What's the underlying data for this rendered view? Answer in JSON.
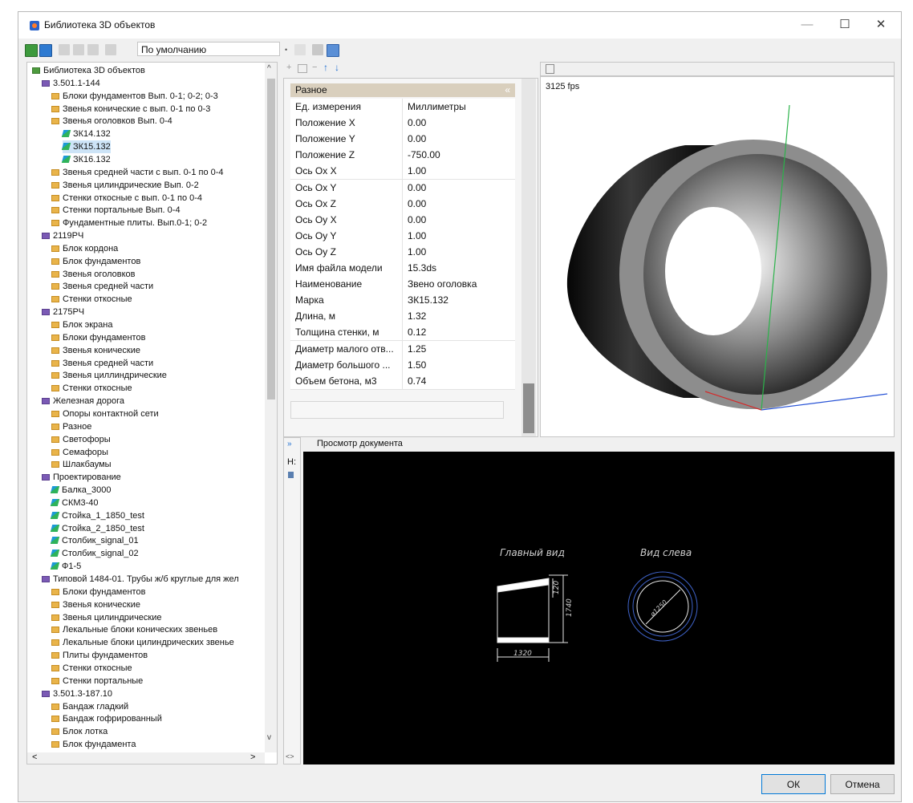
{
  "window": {
    "title": "Библиотека 3D объектов",
    "min_glyph": "—",
    "max_glyph": "☐",
    "close_glyph": "✕"
  },
  "toolbar": {
    "preset_value": "По умолчанию"
  },
  "tree": {
    "scroll_up": "^",
    "scroll_down": "v",
    "scroll_left": "<",
    "scroll_right": ">",
    "items": [
      {
        "label": "Библиотека 3D объектов",
        "level": 0,
        "icon": "lib"
      },
      {
        "label": "3.501.1-144",
        "level": 1,
        "icon": "grp"
      },
      {
        "label": "Блоки фундаментов Вып. 0-1; 0-2; 0-3",
        "level": 2,
        "icon": "folder"
      },
      {
        "label": "Звенья конические с вып. 0-1 по 0-3",
        "level": 2,
        "icon": "folder"
      },
      {
        "label": "Звенья оголовков Вып. 0-4",
        "level": 2,
        "icon": "folder"
      },
      {
        "label": "ЗК14.132",
        "level": 3,
        "icon": "obj"
      },
      {
        "label": "ЗК15.132",
        "level": 3,
        "icon": "obj",
        "selected": true
      },
      {
        "label": "ЗК16.132",
        "level": 3,
        "icon": "obj"
      },
      {
        "label": "Звенья средней части с вып. 0-1 по 0-4",
        "level": 2,
        "icon": "folder"
      },
      {
        "label": "Звенья цилиндрические Вып. 0-2",
        "level": 2,
        "icon": "folder"
      },
      {
        "label": "Стенки откосные с вып. 0-1 по 0-4",
        "level": 2,
        "icon": "folder"
      },
      {
        "label": "Стенки портальные Вып. 0-4",
        "level": 2,
        "icon": "folder"
      },
      {
        "label": "Фундаментные плиты. Вып.0-1; 0-2",
        "level": 2,
        "icon": "folder"
      },
      {
        "label": "2119РЧ",
        "level": 1,
        "icon": "grp"
      },
      {
        "label": "Блок кордона",
        "level": 2,
        "icon": "folder"
      },
      {
        "label": "Блок фундаментов",
        "level": 2,
        "icon": "folder"
      },
      {
        "label": "Звенья оголовков",
        "level": 2,
        "icon": "folder"
      },
      {
        "label": "Звенья средней части",
        "level": 2,
        "icon": "folder"
      },
      {
        "label": "Стенки откосные",
        "level": 2,
        "icon": "folder"
      },
      {
        "label": "2175РЧ",
        "level": 1,
        "icon": "grp"
      },
      {
        "label": "Блок экрана",
        "level": 2,
        "icon": "folder"
      },
      {
        "label": "Блоки фундаментов",
        "level": 2,
        "icon": "folder"
      },
      {
        "label": "Звенья конические",
        "level": 2,
        "icon": "folder"
      },
      {
        "label": "Звенья средней части",
        "level": 2,
        "icon": "folder"
      },
      {
        "label": "Звенья циллиндрические",
        "level": 2,
        "icon": "folder"
      },
      {
        "label": "Стенки откосные",
        "level": 2,
        "icon": "folder"
      },
      {
        "label": "Железная дорога",
        "level": 1,
        "icon": "grp"
      },
      {
        "label": "Опоры контактной сети",
        "level": 2,
        "icon": "folder"
      },
      {
        "label": "Разное",
        "level": 2,
        "icon": "folder"
      },
      {
        "label": "Светофоры",
        "level": 2,
        "icon": "folder"
      },
      {
        "label": "Семафоры",
        "level": 2,
        "icon": "folder"
      },
      {
        "label": "Шлакбаумы",
        "level": 2,
        "icon": "folder"
      },
      {
        "label": "Проектирование",
        "level": 1,
        "icon": "grp"
      },
      {
        "label": "Балка_3000",
        "level": 2,
        "icon": "obj"
      },
      {
        "label": "СКМ3-40",
        "level": 2,
        "icon": "obj"
      },
      {
        "label": "Стойка_1_1850_test",
        "level": 2,
        "icon": "obj"
      },
      {
        "label": "Стойка_2_1850_test",
        "level": 2,
        "icon": "obj"
      },
      {
        "label": "Столбик_signal_01",
        "level": 2,
        "icon": "obj"
      },
      {
        "label": "Столбик_signal_02",
        "level": 2,
        "icon": "obj"
      },
      {
        "label": "Ф1-5",
        "level": 2,
        "icon": "obj"
      },
      {
        "label": "Типовой 1484-01. Трубы ж/б круглые для жел",
        "level": 1,
        "icon": "grp"
      },
      {
        "label": "Блоки фундаментов",
        "level": 2,
        "icon": "folder"
      },
      {
        "label": "Звенья конические",
        "level": 2,
        "icon": "folder"
      },
      {
        "label": "Звенья цилиндрические",
        "level": 2,
        "icon": "folder"
      },
      {
        "label": "Лекальные блоки конических звеньев",
        "level": 2,
        "icon": "folder"
      },
      {
        "label": "Лекальные блоки цилиндрических звенье",
        "level": 2,
        "icon": "folder"
      },
      {
        "label": "Плиты фундаментов",
        "level": 2,
        "icon": "folder"
      },
      {
        "label": "Стенки откосные",
        "level": 2,
        "icon": "folder"
      },
      {
        "label": "Стенки портальные",
        "level": 2,
        "icon": "folder"
      },
      {
        "label": "3.501.3-187.10",
        "level": 1,
        "icon": "grp"
      },
      {
        "label": "Бандаж гладкий",
        "level": 2,
        "icon": "folder"
      },
      {
        "label": "Бандаж гофрированный",
        "level": 2,
        "icon": "folder"
      },
      {
        "label": "Блок лотка",
        "level": 2,
        "icon": "folder"
      },
      {
        "label": "Блок фундамента",
        "level": 2,
        "icon": "folder"
      }
    ]
  },
  "props": {
    "section": "Разное",
    "collapse_glyph": "«",
    "rows": [
      {
        "key": "Ед. измерения",
        "value": "Миллиметры"
      },
      {
        "key": "Положение X",
        "value": "0.00"
      },
      {
        "key": "Положение Y",
        "value": "0.00"
      },
      {
        "key": "Положение Z",
        "value": "-750.00"
      },
      {
        "key": "Ось Ox X",
        "value": "1.00"
      },
      {
        "key": "Ось Ox Y",
        "value": "0.00"
      },
      {
        "key": "Ось Ox Z",
        "value": "0.00"
      },
      {
        "key": "Ось Oy X",
        "value": "0.00"
      },
      {
        "key": "Ось Oy Y",
        "value": "1.00"
      },
      {
        "key": "Ось Oy Z",
        "value": "1.00"
      },
      {
        "key": "Имя файла модели",
        "value": "15.3ds"
      },
      {
        "key": "Наименование",
        "value": "Звено оголовка"
      },
      {
        "key": "Марка",
        "value": "ЗК15.132"
      },
      {
        "key": "Длина, м",
        "value": "1.32"
      },
      {
        "key": "Толщина стенки, м",
        "value": "0.12"
      },
      {
        "key": "Диаметр малого отв...",
        "value": "1.25"
      },
      {
        "key": "Диаметр большого ...",
        "value": "1.50"
      },
      {
        "key": "Объем бетона, м3",
        "value": "0.74"
      }
    ]
  },
  "view3d": {
    "fps": "3125 fps"
  },
  "doc": {
    "title": "Просмотр документа",
    "side_label": "Н:",
    "expand_glyph": "»",
    "nav_glyph": "<>",
    "main_view": "Главный вид",
    "left_view": "Вид слева",
    "dim_width": "1320",
    "dim_height": "1740",
    "dim_small": "120",
    "dim_diameter": "ø1250"
  },
  "buttons": {
    "ok": "ОК",
    "cancel": "Отмена"
  }
}
